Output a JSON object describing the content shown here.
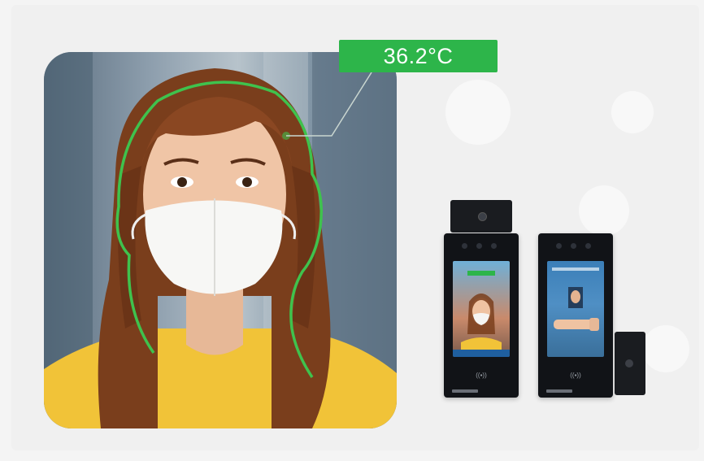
{
  "temperature": {
    "reading": "36.2°C",
    "badge_color": "#2db54a",
    "outline_color": "#3fc24d"
  },
  "devices": [
    {
      "name": "face-recognition-terminal-with-camera"
    },
    {
      "name": "face-recognition-terminal-with-reader"
    }
  ]
}
